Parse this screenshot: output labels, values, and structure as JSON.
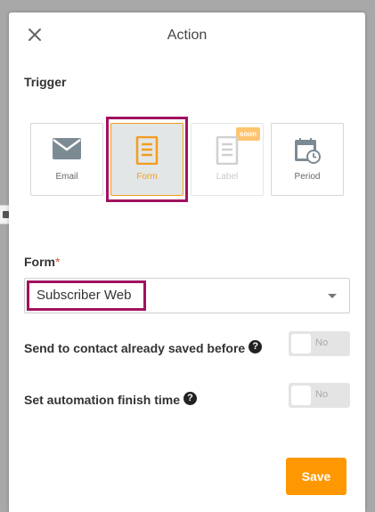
{
  "modal": {
    "title": "Action"
  },
  "trigger": {
    "label": "Trigger",
    "options": [
      {
        "label": "Email",
        "icon": "envelope-icon",
        "selected": false,
        "disabled": false
      },
      {
        "label": "Form",
        "icon": "form-document-icon",
        "selected": true,
        "disabled": false
      },
      {
        "label": "Label",
        "icon": "label-document-icon",
        "selected": false,
        "disabled": true,
        "badge": "soon"
      },
      {
        "label": "Period",
        "icon": "calendar-clock-icon",
        "selected": false,
        "disabled": false
      }
    ]
  },
  "form_field": {
    "label": "Form",
    "required_mark": "*",
    "selected_value": "Subscriber Web"
  },
  "settings": [
    {
      "label": "Send to contact already saved before",
      "help": "?",
      "toggle_text": "No",
      "enabled": false
    },
    {
      "label": "Set automation finish time",
      "help": "?",
      "toggle_text": "No",
      "enabled": false
    }
  ],
  "actions": {
    "save_label": "Save"
  },
  "colors": {
    "accent": "#ff9800",
    "selected_border": "#f29c1f",
    "highlight": "#a0125f",
    "required": "#e0533b"
  }
}
